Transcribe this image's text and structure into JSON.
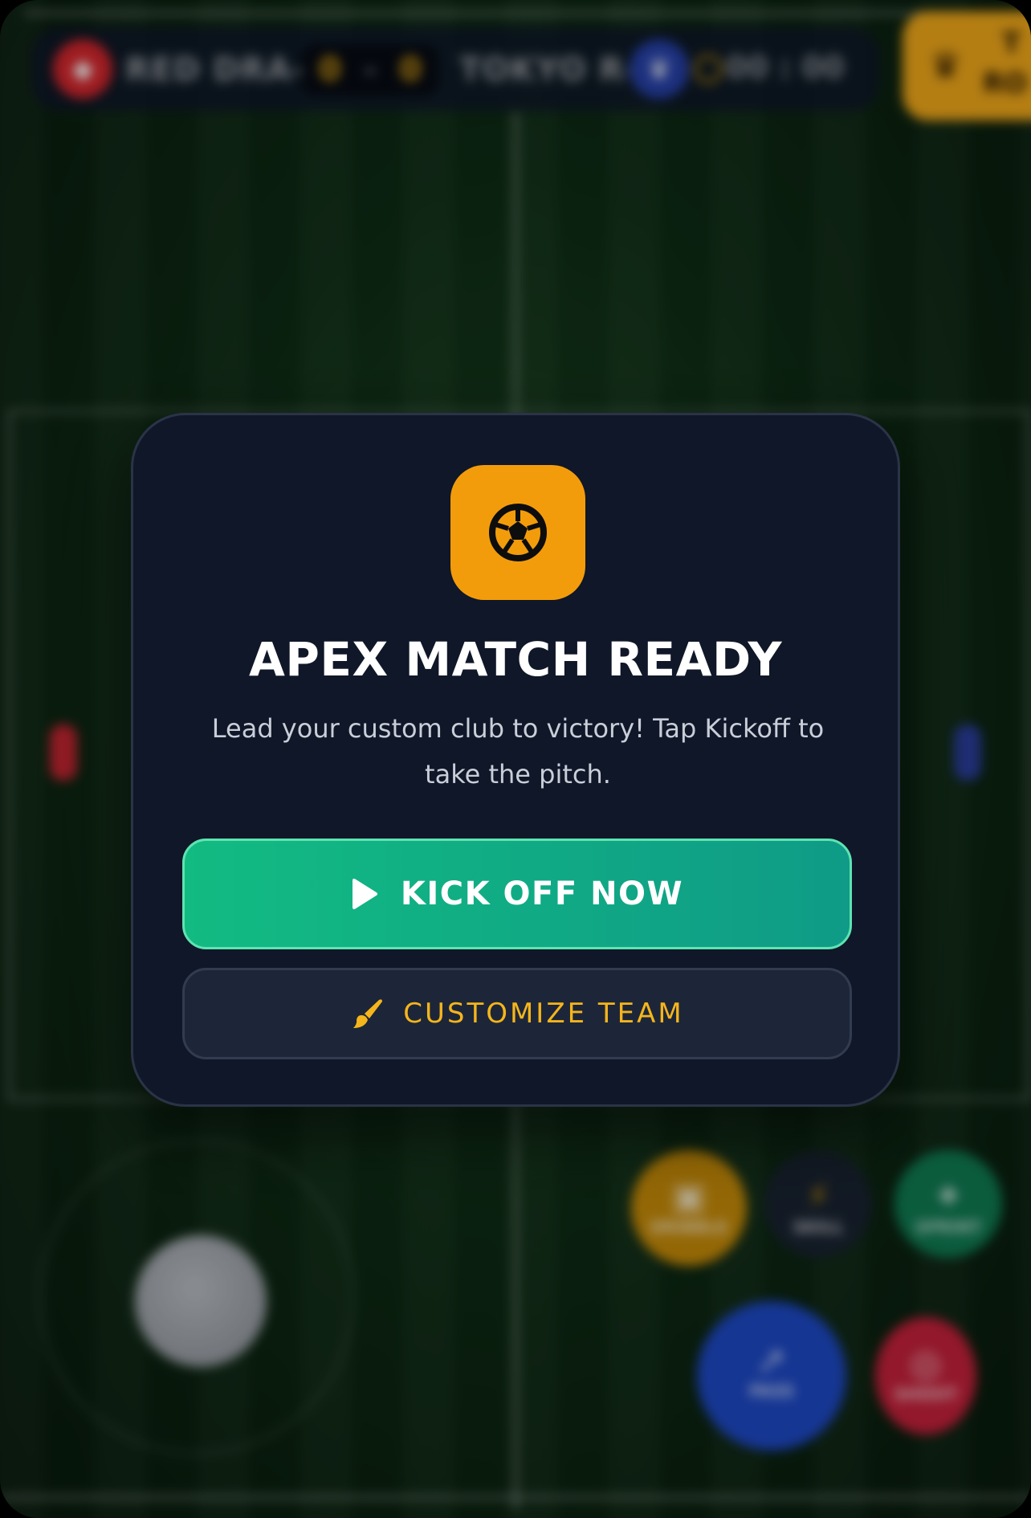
{
  "hud": {
    "home_team": "RED DRA—",
    "away_team": "TOKYO R—",
    "home_score": "0",
    "score_separator": "-",
    "away_score": "0",
    "timer": "00 : 00",
    "home_color": "#d3262c",
    "away_color": "#2640a8",
    "corner_button_text": [
      "T",
      "RO"
    ]
  },
  "controls": {
    "dribble_label": "DRIBBLE",
    "skill_label": "SKILL",
    "sprint_label": "SPRINT",
    "pass_label": "PASS",
    "shoot_label": "SHOOT"
  },
  "modal": {
    "icon": "soccer-ball-icon",
    "title": "APEX MATCH READY",
    "subtitle": "Lead your custom club to victory! Tap Kickoff to take the pitch.",
    "primary_button": {
      "label": "KICK OFF NOW",
      "icon": "play-icon"
    },
    "secondary_button": {
      "label": "CUSTOMIZE TEAM",
      "icon": "paintbrush-icon"
    }
  },
  "colors": {
    "accent_orange": "#f39c0b",
    "kickoff_green": "#12bb82",
    "customize_text": "#f5b51c",
    "modal_bg": "#0f1728"
  }
}
